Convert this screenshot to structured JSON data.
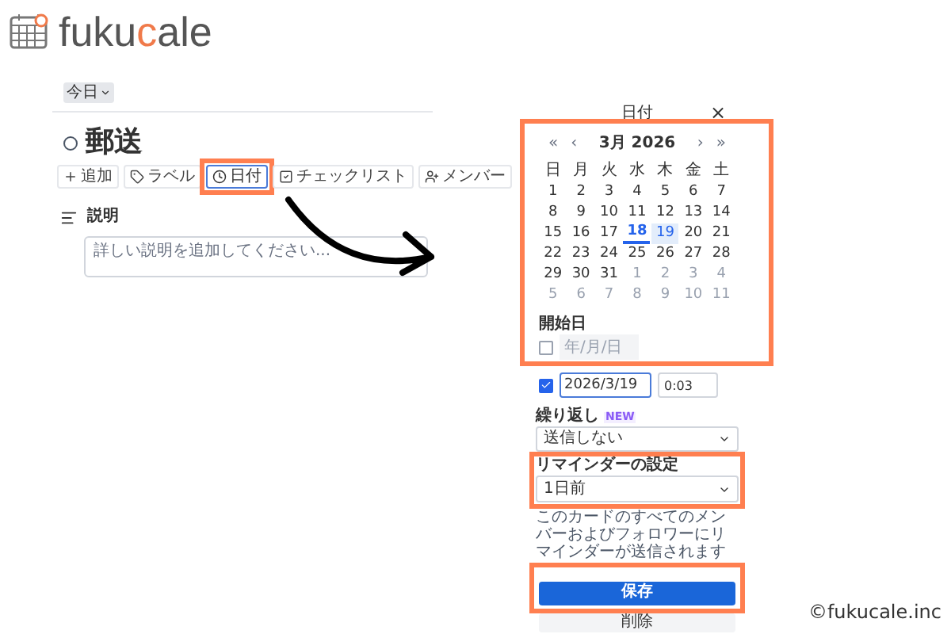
{
  "logo": {
    "parts": [
      {
        "text": "fuku",
        "accent": false
      },
      {
        "text": "c",
        "accent": true
      },
      {
        "text": "ale",
        "accent": false
      }
    ]
  },
  "view_button": {
    "label": "今日"
  },
  "task": {
    "title": "郵送",
    "done": false
  },
  "actions": [
    {
      "kind": "plus",
      "label": "追加",
      "active": false
    },
    {
      "kind": "tag",
      "label": "ラベル",
      "active": false
    },
    {
      "kind": "clock",
      "label": "日付",
      "active": true
    },
    {
      "kind": "checkbox",
      "label": "チェックリスト",
      "active": false
    },
    {
      "kind": "person",
      "label": "メンバー",
      "active": false
    }
  ],
  "description": {
    "label": "説明",
    "placeholder": "詳しい説明を追加してください..."
  },
  "date_panel": {
    "title": "日付",
    "close": "×",
    "calendar": {
      "nav_back": [
        "«",
        "‹"
      ],
      "month": "3月 2026",
      "nav_forward": [
        "›",
        "»"
      ],
      "weekdays": [
        "日",
        "月",
        "火",
        "水",
        "木",
        "金",
        "土"
      ],
      "days": [
        {
          "label": "1",
          "muted": false,
          "today": false,
          "selected": false
        },
        {
          "label": "2",
          "muted": false,
          "today": false,
          "selected": false
        },
        {
          "label": "3",
          "muted": false,
          "today": false,
          "selected": false
        },
        {
          "label": "4",
          "muted": false,
          "today": false,
          "selected": false
        },
        {
          "label": "5",
          "muted": false,
          "today": false,
          "selected": false
        },
        {
          "label": "6",
          "muted": false,
          "today": false,
          "selected": false
        },
        {
          "label": "7",
          "muted": false,
          "today": false,
          "selected": false
        },
        {
          "label": "8",
          "muted": false,
          "today": false,
          "selected": false
        },
        {
          "label": "9",
          "muted": false,
          "today": false,
          "selected": false
        },
        {
          "label": "10",
          "muted": false,
          "today": false,
          "selected": false
        },
        {
          "label": "11",
          "muted": false,
          "today": false,
          "selected": false
        },
        {
          "label": "12",
          "muted": false,
          "today": false,
          "selected": false
        },
        {
          "label": "13",
          "muted": false,
          "today": false,
          "selected": false
        },
        {
          "label": "14",
          "muted": false,
          "today": false,
          "selected": false
        },
        {
          "label": "15",
          "muted": false,
          "today": false,
          "selected": false
        },
        {
          "label": "16",
          "muted": false,
          "today": false,
          "selected": false
        },
        {
          "label": "17",
          "muted": false,
          "today": false,
          "selected": false
        },
        {
          "label": "18",
          "muted": false,
          "today": true,
          "selected": false
        },
        {
          "label": "19",
          "muted": false,
          "today": false,
          "selected": true
        },
        {
          "label": "20",
          "muted": false,
          "today": false,
          "selected": false
        },
        {
          "label": "21",
          "muted": false,
          "today": false,
          "selected": false
        },
        {
          "label": "22",
          "muted": false,
          "today": false,
          "selected": false
        },
        {
          "label": "23",
          "muted": false,
          "today": false,
          "selected": false
        },
        {
          "label": "24",
          "muted": false,
          "today": false,
          "selected": false
        },
        {
          "label": "25",
          "muted": false,
          "today": false,
          "selected": false
        },
        {
          "label": "26",
          "muted": false,
          "today": false,
          "selected": false
        },
        {
          "label": "27",
          "muted": false,
          "today": false,
          "selected": false
        },
        {
          "label": "28",
          "muted": false,
          "today": false,
          "selected": false
        },
        {
          "label": "29",
          "muted": false,
          "today": false,
          "selected": false
        },
        {
          "label": "30",
          "muted": false,
          "today": false,
          "selected": false
        },
        {
          "label": "31",
          "muted": false,
          "today": false,
          "selected": false
        },
        {
          "label": "1",
          "muted": true,
          "today": false,
          "selected": false
        },
        {
          "label": "2",
          "muted": true,
          "today": false,
          "selected": false
        },
        {
          "label": "3",
          "muted": true,
          "today": false,
          "selected": false
        },
        {
          "label": "4",
          "muted": true,
          "today": false,
          "selected": false
        },
        {
          "label": "5",
          "muted": true,
          "today": false,
          "selected": false
        },
        {
          "label": "6",
          "muted": true,
          "today": false,
          "selected": false
        },
        {
          "label": "7",
          "muted": true,
          "today": false,
          "selected": false
        },
        {
          "label": "8",
          "muted": true,
          "today": false,
          "selected": false
        },
        {
          "label": "9",
          "muted": true,
          "today": false,
          "selected": false
        },
        {
          "label": "10",
          "muted": true,
          "today": false,
          "selected": false
        },
        {
          "label": "11",
          "muted": true,
          "today": false,
          "selected": false
        }
      ]
    },
    "start": {
      "label": "開始日",
      "checked": false,
      "placeholder": "年/月/日"
    },
    "due": {
      "checked": true,
      "date": "2026/3/19",
      "time": "0:03"
    },
    "repeat": {
      "label": "繰り返し",
      "badge": "NEW",
      "value": "送信しない"
    },
    "reminder": {
      "label": "リマインダーの設定",
      "value": "1日前"
    },
    "note": "このカードのすべてのメンバーおよびフォロワーにリマインダーが送信されます",
    "save": "保存",
    "delete": "削除"
  },
  "copyright": "©fukucale.inc"
}
